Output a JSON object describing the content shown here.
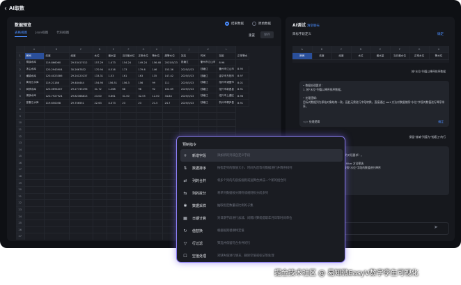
{
  "app": {
    "title": "AI取数",
    "back_icon": "chevron-left-icon"
  },
  "left": {
    "title": "数据预览",
    "tabs": [
      "表格视图",
      "Json视图",
      "代码视图"
    ],
    "radio_result": "结果数据",
    "radio_raw": "原始数据",
    "reset": "重置",
    "save": "保存",
    "col_letters": [
      "A",
      "B",
      "C",
      "D",
      "E",
      "F",
      "G",
      "H",
      "I",
      "J",
      "K",
      "L"
    ],
    "headers": [
      "房间",
      "纬度",
      "经度",
      "水位",
      "最水量",
      "当日最水位",
      "正常水位",
      "警水位",
      "超警水位",
      "站站",
      "时间",
      "站组",
      "正常警水"
    ],
    "rows": [
      [
        "1",
        "桐溪水库",
        "119.866060",
        "29.53417012",
        "157.29",
        "1.473",
        "154.24",
        "149.24",
        "156.48",
        "2025/5/23",
        "钱塘江",
        "衢州市江山市",
        "8.96"
      ],
      [
        "2",
        "沐尘水库",
        "120.2943904",
        "30.2667832",
        "170.94",
        "0.516",
        "173",
        "179.6",
        "146",
        "153.36",
        "2025/5/23",
        "钱塘江",
        "衢州市江山市",
        "8.95"
      ],
      [
        "3",
        "横锦水库",
        "120.4023386",
        "29.24120237",
        "133.31",
        "1.53",
        "161",
        "163",
        "135",
        "147.42",
        "2025/5/23",
        "钱塘江",
        "金华市东阳市",
        "8.97"
      ],
      [
        "4",
        "黄泥江水库",
        "119.21186",
        "29.484444",
        "154.90",
        "156.51",
        "156.3",
        "156",
        "99",
        "111",
        "2025/5/23",
        "钱塘江",
        "绍州市诸暨市",
        "8.01"
      ],
      [
        "5",
        "岗峡水库",
        "120.0694407",
        "29.27745196",
        "31.72",
        "1.268",
        "68",
        "98",
        "92",
        "102.69",
        "2025/5/23",
        "钱塘江",
        "绍兴市新昌县",
        "8.91"
      ],
      [
        "6",
        "湖溪水库",
        "120.7927924",
        "29.82368813",
        "23.00",
        "0.661",
        "31.00",
        "32.55",
        "12.00",
        "34.84",
        "2025/5/23",
        "钱塘江",
        "绍兴市上虞区",
        "8.96"
      ],
      [
        "7",
        "富春江水库",
        "119.650058",
        "29.756551",
        "22.63",
        "4.373",
        "23",
        "23",
        "21.5",
        "24.7",
        "2025/5/23",
        "钱塘江",
        "杭州市桐庐县",
        "8.91"
      ]
    ],
    "empty_rows": [
      "8",
      "9",
      "10",
      "11",
      "12",
      "13",
      "14",
      "15",
      "16",
      "17",
      "18",
      "19",
      "20",
      "21",
      "22",
      "23",
      "24",
      "25",
      "26",
      "27",
      "28",
      "29",
      "30",
      "31"
    ]
  },
  "right": {
    "title": "AI调试",
    "title_link": "清空聊天",
    "subtitle": "目标字段定义",
    "confirm": "确定",
    "col_letters": [
      "A",
      "B",
      "C",
      "D",
      "E",
      "F",
      "G",
      "H"
    ],
    "headers": [
      "房间",
      "纬度",
      "经度",
      "水位",
      "最水量",
      "当日最水位",
      "正常水位",
      "警水位"
    ],
    "user_msg1": "按\"水位\"列值以降序排序数据",
    "ai_lines": [
      "• 数据处理要求：",
      "1. 按\"水位\"列值以降序排序数据。",
      "",
      "• 处理逻辑：",
      "目标对数据列为原始对象结构一致，因此无需进行字段转换，直接通过 sort 方法对数据按照\"水位\"字段的数值进行降序排序。"
    ],
    "ai_tag": "处理逻辑",
    "ai_apply": "确定",
    "user_msg2": "保留\"流域\"列值为\"钱塘江\"的行",
    "ai2_lines": [
      "...\"钱塘江\"的行。",
      "...按照前面的\"水位\"排序（来自之前的对话要求）。",
      "",
      "...因此无需进行字段转换，直接通过 filter 方法筛选",
      "...的行，然后通过 sort 方法对数据按照\"水位\"字段的数值进行降序"
    ]
  },
  "popup": {
    "title": "预制指令",
    "items": [
      {
        "icon": "plus-icon",
        "glyph": "+",
        "name": "新增字段",
        "desc": "添加新的列或自定义字段"
      },
      {
        "icon": "sort-icon",
        "glyph": "⇅",
        "name": "数据排序",
        "desc": "按指定列的数值大小、时间先后等对数据进行升降序排列"
      },
      {
        "icon": "merge-icon",
        "glyph": "⇄",
        "name": "列的合并",
        "desc": "将多个列的内容按规则或运算合并成一个新的组合列"
      },
      {
        "icon": "split-icon",
        "glyph": "⇆",
        "name": "列的拆分",
        "desc": "将单列数据按分隔符或规则拆分成多列"
      },
      {
        "icon": "sample-icon",
        "glyph": "✱",
        "name": "数据采样",
        "desc": "抽取指定数量或比例的子集"
      },
      {
        "icon": "calendar-icon",
        "glyph": "▦",
        "name": "日期计算",
        "desc": "对日期字段进行加减、间隔计算或提取年月日等时间单位"
      },
      {
        "icon": "replace-icon",
        "glyph": "↻",
        "name": "值替换",
        "desc": "根据规则替换特定值"
      },
      {
        "icon": "filter-icon",
        "glyph": "▽",
        "name": "行过滤",
        "desc": "筛选并保留符合条件的行"
      },
      {
        "icon": "null-icon",
        "glyph": "☐",
        "name": "空值处理",
        "desc": "对缺失值进行填充、删除空值或标记等处理"
      }
    ]
  },
  "footer": "掘金技术社区 @ 易知微EasyV数字孪生可视化"
}
